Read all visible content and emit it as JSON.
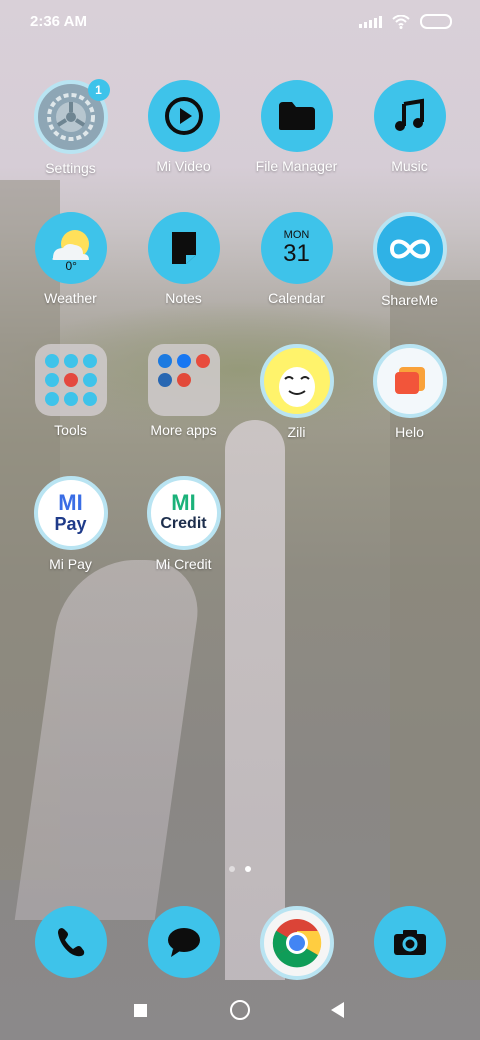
{
  "status": {
    "time": "2:36 AM"
  },
  "apps": {
    "settings": {
      "label": "Settings",
      "badge": "1"
    },
    "mi_video": {
      "label": "Mi Video"
    },
    "file_manager": {
      "label": "File Manager"
    },
    "music": {
      "label": "Music"
    },
    "weather": {
      "label": "Weather",
      "temp": "0°"
    },
    "notes": {
      "label": "Notes"
    },
    "calendar": {
      "label": "Calendar",
      "day": "MON",
      "date": "31"
    },
    "shareme": {
      "label": "ShareMe"
    },
    "tools": {
      "label": "Tools"
    },
    "more_apps": {
      "label": "More apps"
    },
    "zili": {
      "label": "Zili"
    },
    "helo": {
      "label": "Helo"
    },
    "mi_pay": {
      "label": "Mi Pay",
      "logo_top": "MI",
      "logo_bottom": "Pay"
    },
    "mi_credit": {
      "label": "Mi Credit",
      "logo_top": "MI",
      "logo_bottom": "Credit"
    }
  },
  "dock": {
    "phone": "phone-icon",
    "messages": "message-icon",
    "chrome": "chrome-icon",
    "camera": "camera-icon"
  },
  "page_indicator": {
    "pages": 2,
    "current": 2
  },
  "colors": {
    "accent": "#3ec3ea"
  }
}
